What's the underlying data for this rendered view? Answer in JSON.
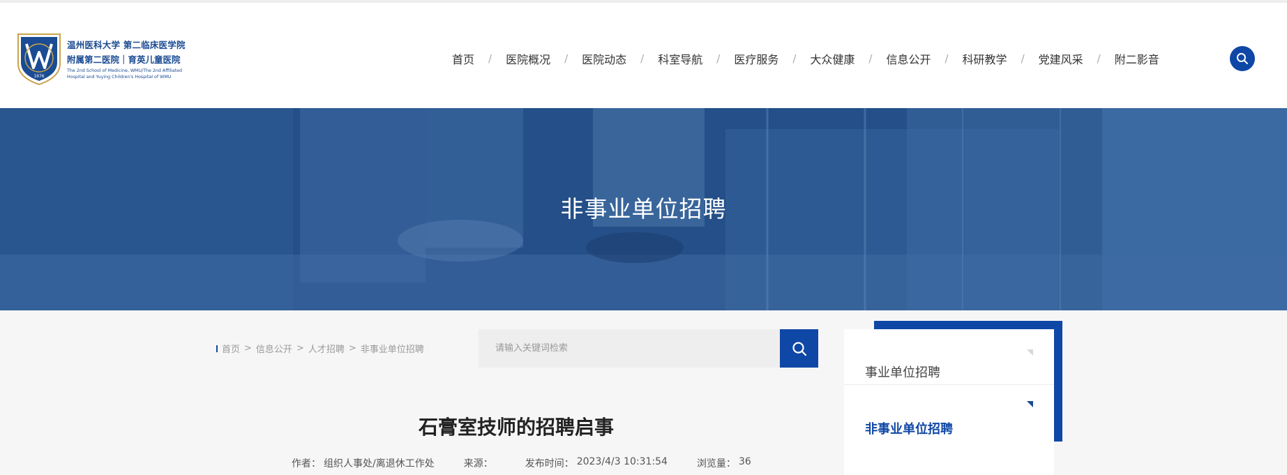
{
  "header": {
    "logo": {
      "line1": "温州医科大学 第二临床医学院",
      "line2": "附属第二医院｜育英儿童医院",
      "line3a": "The 2nd School of Medicine, WMU/The 2nd Affiliated",
      "line3b": "Hospital and Yuying Children's Hospital of WMU",
      "year": "1976"
    },
    "nav": [
      {
        "label": "首页"
      },
      {
        "label": "医院概况"
      },
      {
        "label": "医院动态"
      },
      {
        "label": "科室导航"
      },
      {
        "label": "医疗服务"
      },
      {
        "label": "大众健康"
      },
      {
        "label": "信息公开"
      },
      {
        "label": "科研教学"
      },
      {
        "label": "党建风采"
      },
      {
        "label": "附二影音"
      }
    ],
    "separator": "/"
  },
  "banner": {
    "title": "非事业单位招聘"
  },
  "breadcrumb": {
    "items": [
      "首页",
      "信息公开",
      "人才招聘",
      "非事业单位招聘"
    ],
    "arrow": ">"
  },
  "search": {
    "placeholder": "请输入关键词检索"
  },
  "article": {
    "title": "石膏室技师的招聘启事",
    "author_label": "作者：",
    "author": "组织人事处/离退休工作处",
    "source_label": "来源：",
    "source": "",
    "date_label": "发布时间：",
    "date": "2023/4/3 10:31:54",
    "views_label": "浏览量：",
    "views": "36"
  },
  "sidebar": {
    "items": [
      {
        "label": "事业单位招聘"
      },
      {
        "label": "非事业单位招聘"
      }
    ]
  },
  "colors": {
    "brand_blue": "#0f47a6",
    "logo_blue": "#1b4b92",
    "banner_blue": "#2a5c96"
  }
}
